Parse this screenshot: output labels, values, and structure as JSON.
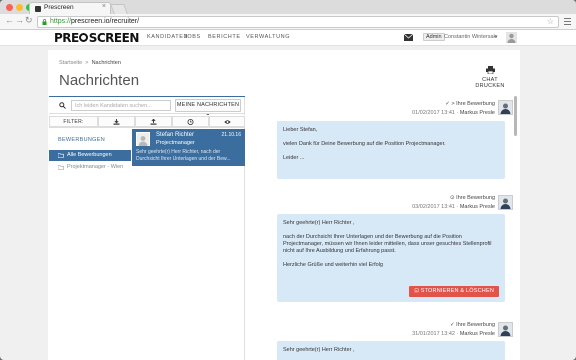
{
  "browser": {
    "tab_title": "Prescreen",
    "url_protocol": "https://",
    "url_rest": "prescreen.io/recruiter/"
  },
  "header": {
    "logo_left": "PRE",
    "logo_right": "SCREEN",
    "nav": [
      "KANDIDATEN",
      "JOBS",
      "BERICHTE",
      "VERWALTUNG"
    ],
    "admin_badge": "Admin",
    "user_name": "Constantin Wintersak"
  },
  "page": {
    "breadcrumb_home": "Startseite",
    "breadcrumb_sep": ">",
    "breadcrumb_current": "Nachrichten",
    "title": "Nachrichten",
    "chat_print_label": "CHAT DRUCKEN"
  },
  "search": {
    "placeholder": "Ich leiden Kandidaten suchen...",
    "my_messages_label": "MEINE NACHRICHTEN ▾"
  },
  "filter": {
    "label": "FILTER:"
  },
  "folders": {
    "title": "BEWERBUNGEN",
    "items": [
      {
        "label": "Alle Bewerbungen"
      },
      {
        "label": "Projektmanager - Wien"
      }
    ]
  },
  "conversations": [
    {
      "name": "Stefan Richter",
      "date": "21.10.16",
      "role": "Projectmanager",
      "snippet": "Sehr geehrte(r) Herr Richter, nach der Durchsicht Ihrer Unterlagen und der Bew..."
    }
  ],
  "messages": [
    {
      "status": "✓ > Ihre Bewerbung",
      "time": "01/02/2017 13:41",
      "author": "Markus Presle",
      "paragraphs": [
        "Lieber Stefan,",
        "vielen Dank für Deine Bewerbung auf die Position Projectmanager.",
        "Leider ..."
      ]
    },
    {
      "status": "⊙ Ihre Bewerbung",
      "time": "03/02/2017 13:41",
      "author": "Markus Presle",
      "paragraphs": [
        "Sehr geehrte(r) Herr Richter ,",
        "nach der Durchsicht Ihrer Unterlagen und der Bewerbung auf die Position Projectmanager, müssen wir Ihnen leider mitteilen, dass unser gesuchtes Stellenprofil nicht auf Ihre Ausbildung und Erfahrung passt.",
        "Herzliche Grüße und weiterhin viel Erfolg"
      ],
      "delete_label": "⊡ STORNIEREN & LÖSCHEN"
    },
    {
      "status": "✓ Ihre Bewerbung",
      "time": "31/01/2017 13:42",
      "author": "Markus Presle",
      "paragraphs": [
        "Sehr geehrte(r) Herr Richter ,"
      ]
    }
  ],
  "colors": {
    "accent": "#3b6e9e",
    "bubble": "#d7e8f7",
    "danger": "#e2544a"
  }
}
